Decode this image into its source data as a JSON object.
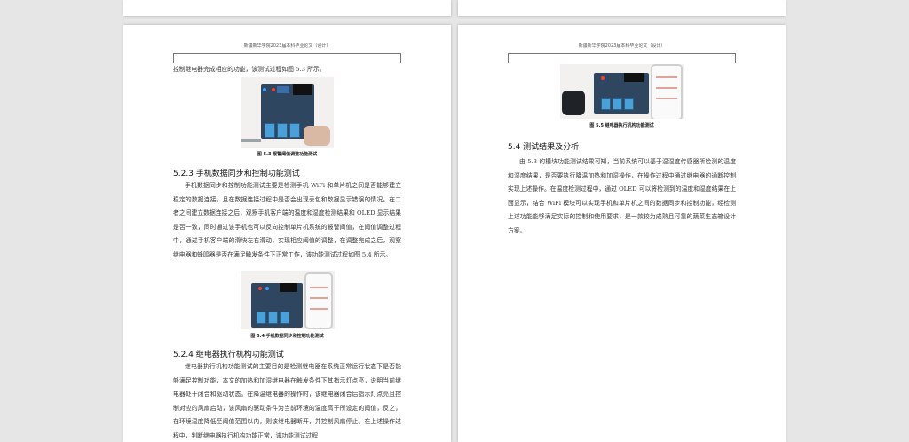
{
  "header_text": "新疆新华学院2023届本科毕业论文（设计）",
  "left_page": {
    "intro_line": "控制继电器完成相应的功能，该测试过程如图 5.3 所示。",
    "fig53_caption": "图 5.3 报警阈值调整功能测试",
    "section_523_title": "5.2.3 手机数据同步和控制功能测试",
    "para_523": "手机数据同步和控制功能测试主要是检测手机 WiFi 和单片机之间是否能够建立稳定的数据连接，且在数据连接过程中是否会出现丢包和数据显示错误的情况。在二者之间建立数据连接之后，观察手机客户端的温度和湿度检测结果和 OLED 显示结果是否一致，同时通过该手机也可以反向控制单片机系统的报警阈值，在阈值调整过程中，通过手机客户端的滑块左右滑动，实现相应阈值的调整，在调整完成之后，观察继电器和蜂鸣器是否在满足触发条件下正常工作，该功能测试过程如图 5.4 所示。",
    "fig54_caption": "图 5.4 手机数据同步和控制功能测试",
    "section_524_title": "5.2.4 继电器执行机构功能测试",
    "para_524": "继电器执行机构功能测试的主要目的是检测继电器在系统正常运行状态下是否能够满足控制功能，本文的加热和加湿继电器在触发条件下其指示灯点亮，说明当前继电器处于闭合和驱动状态。在降温继电器的操作时，该继电器闭合后指示灯点亮且控制对应的风扇启动，该风扇的驱动条件为当前环境的温度高于所设定的阈值，反之，在环境温度降低至阈值范围以内，则该继电器断开，并控制风扇停止。在上述操作过程中，判断继电器执行机构功能正常，该功能测试过程"
  },
  "right_page": {
    "fig55_caption": "图 5.5 继电器执行机构功能测试",
    "section_54_title": "5.4 测试结果及分析",
    "para_54": "由 5.3 的模块功能测试结果可知，当前系统可以基于温湿度传感器所检测的温度和湿度结果，是否要执行降温加热和加湿操作，在操作过程中通过继电器的通断控制实现上述操作。在温度检测过程中，通过 OLED 可以将检测到的温度和湿度结果在上面显示，结合 WiFi 模块可以实现手机和单片机之间的数据同步和控制功能，经检测上述功能能够满足实际的控制和使用要求，是一款较为成熟且可靠的蔬菜生态箱设计方案。"
  }
}
